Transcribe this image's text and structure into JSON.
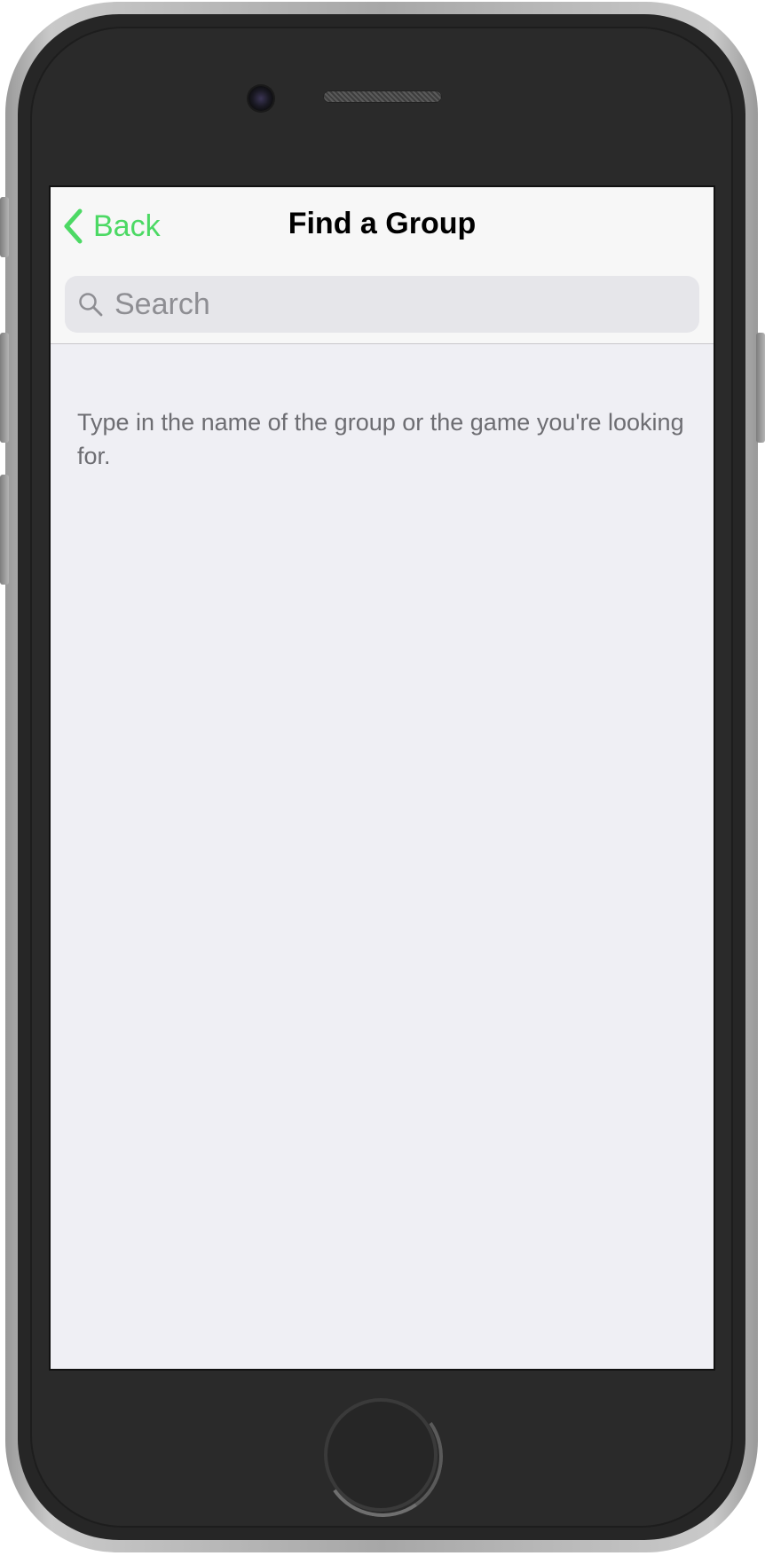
{
  "header": {
    "back_label": "Back",
    "title": "Find a Group"
  },
  "search": {
    "placeholder": "Search",
    "value": ""
  },
  "main": {
    "hint": "Type in the name of the group or the game you're looking for."
  },
  "icons": {
    "back": "chevron-left-icon",
    "search": "search-icon"
  },
  "colors": {
    "accent": "#4cd964",
    "background": "#efeff4",
    "navbar": "#f7f7f7",
    "search_field": "#e6e6ea",
    "hint_text": "#6d6d72"
  }
}
